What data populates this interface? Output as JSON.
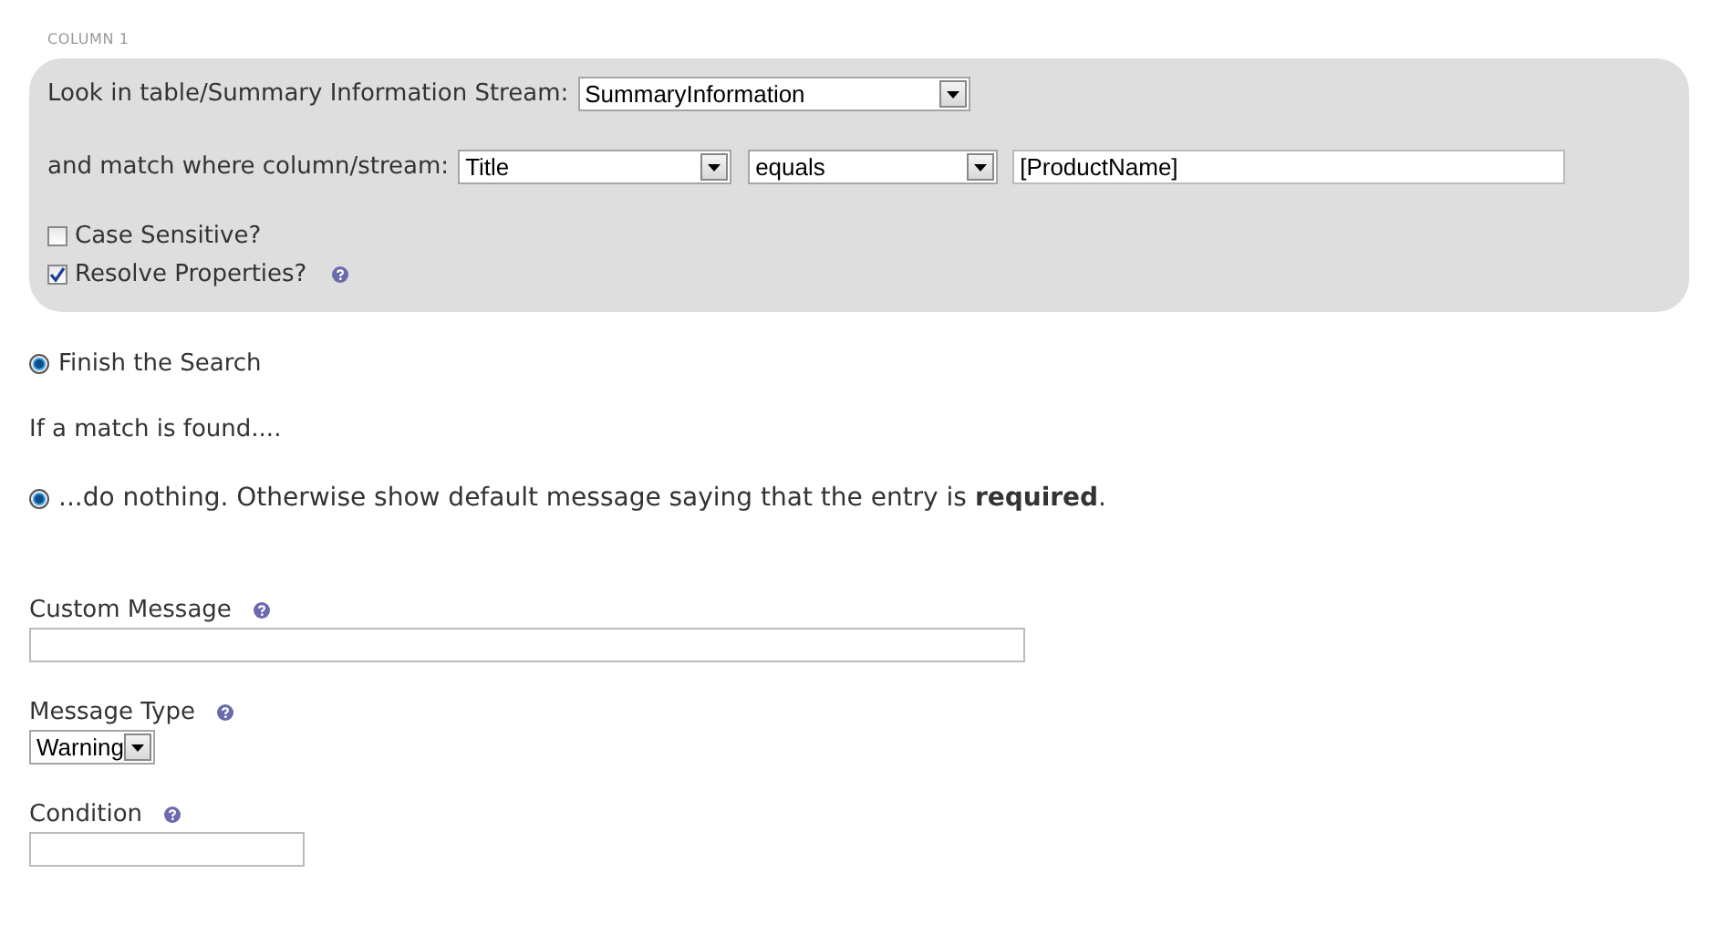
{
  "column_label": "COLUMN 1",
  "lookup": {
    "label": "Look in table/Summary Information Stream:",
    "table_select": {
      "value": "SummaryInformation"
    }
  },
  "match": {
    "label": "and match where column/stream:",
    "column_select": {
      "value": "Title"
    },
    "operator_select": {
      "value": "equals"
    },
    "value_field": {
      "value": "[ProductName]"
    }
  },
  "options": [
    {
      "label": "Case Sensitive?",
      "checked": false,
      "help": false
    },
    {
      "label": "Resolve Properties?",
      "checked": true,
      "help": true
    }
  ],
  "finish_option": {
    "label": "Finish the Search",
    "selected": true
  },
  "match_heading": "If a match is found....",
  "match_action": {
    "label": "...do nothing. Otherwise show default message saying that the entry is **required**.",
    "selected": true
  },
  "fields": [
    {
      "kind": "text",
      "label": "Custom Message"
    },
    {
      "kind": "select",
      "label": "Message Type",
      "value": "Warning"
    },
    {
      "kind": "text",
      "label": "Condition"
    }
  ]
}
